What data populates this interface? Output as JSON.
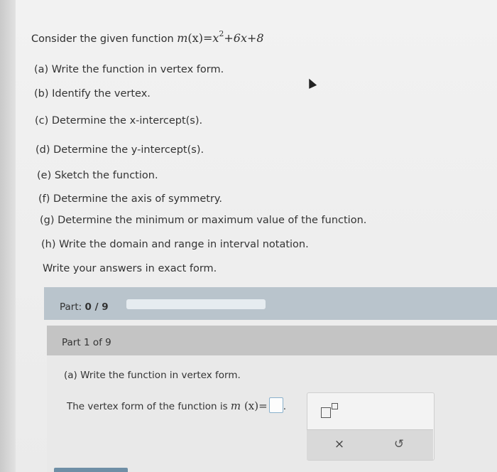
{
  "question": {
    "intro": "Consider the given function ",
    "function_name": "m",
    "function_arg": "(x)",
    "function_eq": "=x",
    "exponent": "2",
    "function_rest": "+6x+8",
    "items": [
      "(a) Write the function in vertex form.",
      "(b) Identify the vertex.",
      "(c) Determine the x-intercept(s).",
      "(d) Determine the y-intercept(s).",
      "(e) Sketch the function.",
      "(f) Determine the axis of symmetry.",
      "(g) Determine the minimum or maximum value of the function.",
      "(h) Write the domain and range in interval notation."
    ],
    "exact_note": "Write your answers in exact form."
  },
  "progress": {
    "label": "Part: ",
    "value": "0 / 9",
    "fraction": 0
  },
  "part": {
    "header": "Part 1 of 9",
    "subquestion": "(a) Write the function in vertex form.",
    "answer_prefix": "The vertex form of the function is ",
    "answer_fn": "m",
    "answer_arg": "(x)",
    "answer_eq": "=",
    "answer_suffix": "."
  },
  "tools": {
    "clear_symbol": "×",
    "undo_symbol": "↺",
    "exponent_icon": "exponent-template-icon"
  },
  "colors": {
    "progress_bar": "#b9c4cc",
    "part_header": "#c4c4c4",
    "answer_box_border": "#8ab1cc"
  }
}
